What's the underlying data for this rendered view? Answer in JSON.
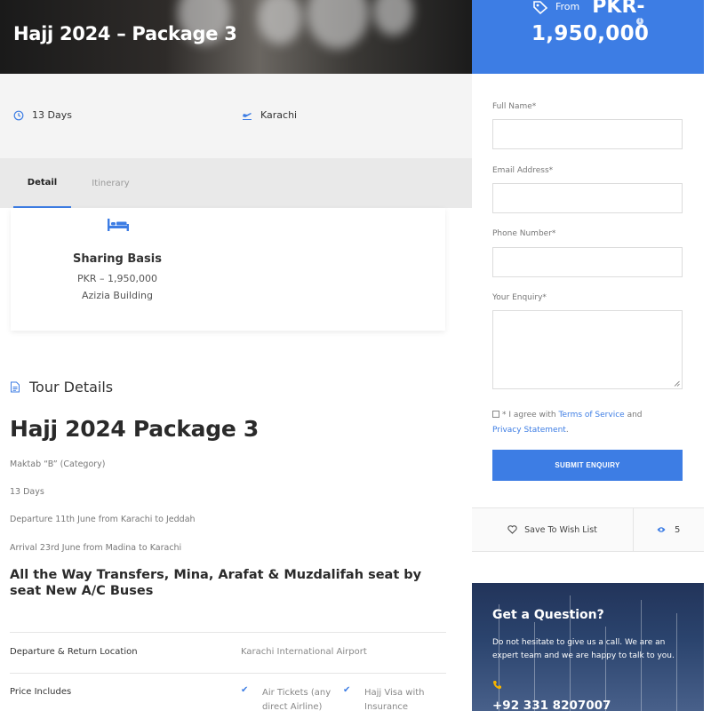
{
  "hero": {
    "title": "Hajj 2024 – Package 3"
  },
  "price": {
    "from_label": "From",
    "currency": "PKR-",
    "amount": "1,950,000",
    "info_icon": "info-icon",
    "tag_icon": "price-tag-icon"
  },
  "meta": {
    "duration": {
      "icon": "clock-icon",
      "value": "13 Days"
    },
    "location": {
      "icon": "plane-departure-icon",
      "value": "Karachi"
    }
  },
  "tabs": [
    {
      "label": "Detail",
      "active": true
    },
    {
      "label": "Itinerary",
      "active": false
    }
  ],
  "sharing": {
    "icon": "bed-icon",
    "title": "Sharing Basis",
    "price": "PKR – 1,950,000",
    "building": "Azizia Building"
  },
  "tour_details": {
    "icon": "document-icon",
    "heading": "Tour Details",
    "package_title": "Hajj 2024 Package 3",
    "lines": [
      "Maktab “B” (Category)",
      "13 Days",
      "Departure 11th June from Karachi to Jeddah",
      "Arrival 23rd June from Madina to Karachi"
    ],
    "transfer_heading": "All the Way Transfers, Mina, Arafat & Muzdalifah seat by seat New A/C Buses"
  },
  "table": {
    "departure": {
      "label": "Departure & Return Location",
      "value": "Karachi International Airport"
    },
    "includes": {
      "label": "Price Includes",
      "items": [
        "Air Tickets (any direct Airline)",
        "Hajj Visa with Insurance"
      ]
    }
  },
  "form": {
    "full_name_label": "Full Name*",
    "email_label": "Email Address*",
    "phone_label": "Phone Number*",
    "enquiry_label": "Your Enquiry*",
    "agree_prefix": "* I agree with",
    "terms_link": "Terms of Service",
    "agree_and": "and",
    "privacy_link": "Privacy Statement",
    "agree_suffix": ".",
    "submit_label": "SUBMIT ENQUIRY"
  },
  "wishlist": {
    "icon": "heart-icon",
    "label": "Save To Wish List",
    "views_icon": "eye-icon",
    "views_count": "5"
  },
  "question": {
    "title": "Get a Question?",
    "text": "Do not hesitate to give us a call. We are an expert team and we are happy to talk to you.",
    "phone_icon": "phone-icon",
    "phone": "+92 331 8207007"
  },
  "colors": {
    "accent": "#3d7de4",
    "question_bg": "#22345a"
  }
}
